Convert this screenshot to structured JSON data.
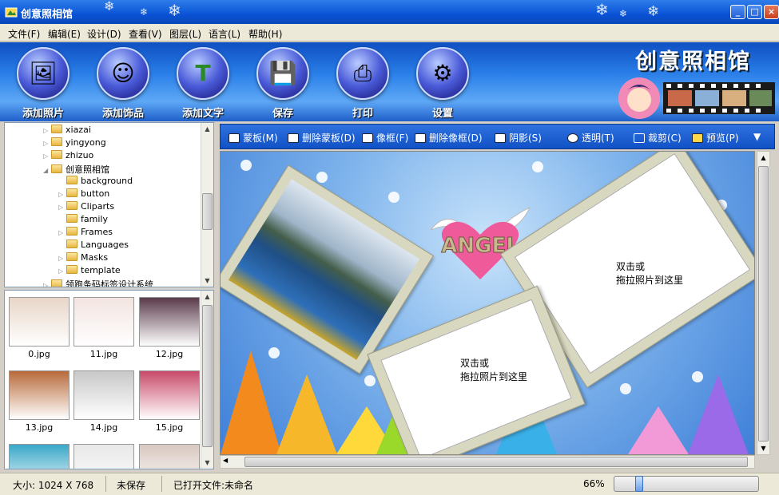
{
  "window": {
    "title": "创意照相馆",
    "minimize": "_",
    "maximize": "□",
    "close": "×"
  },
  "menu": [
    "文件(F)",
    "编辑(E)",
    "设计(D)",
    "查看(V)",
    "图层(L)",
    "语言(L)",
    "帮助(H)"
  ],
  "toolbar": {
    "buttons": [
      {
        "label": "添加照片",
        "icon": "add-photo-icon"
      },
      {
        "label": "添加饰品",
        "icon": "add-decoration-icon"
      },
      {
        "label": "添加文字",
        "icon": "add-text-icon"
      },
      {
        "label": "保存",
        "icon": "save-icon"
      },
      {
        "label": "打印",
        "icon": "print-icon"
      },
      {
        "label": "设置",
        "icon": "settings-icon"
      }
    ],
    "brand": "创意照相馆"
  },
  "tree": {
    "items": [
      {
        "label": "xiazai",
        "level": 0,
        "expander": "▷"
      },
      {
        "label": "yingyong",
        "level": 0,
        "expander": "▷"
      },
      {
        "label": "zhizuo",
        "level": 0,
        "expander": "▷"
      },
      {
        "label": "创意照相馆",
        "level": 0,
        "expander": "◢"
      },
      {
        "label": "background",
        "level": 1,
        "expander": ""
      },
      {
        "label": "button",
        "level": 1,
        "expander": "▷"
      },
      {
        "label": "Cliparts",
        "level": 1,
        "expander": "▷"
      },
      {
        "label": "family",
        "level": 1,
        "expander": ""
      },
      {
        "label": "Frames",
        "level": 1,
        "expander": "▷"
      },
      {
        "label": "Languages",
        "level": 1,
        "expander": ""
      },
      {
        "label": "Masks",
        "level": 1,
        "expander": "▷"
      },
      {
        "label": "template",
        "level": 1,
        "expander": "▷"
      },
      {
        "label": "领跑条码标签设计系统",
        "level": 0,
        "expander": "▷"
      }
    ]
  },
  "thumbnails": [
    {
      "file": "0.jpg",
      "color": "#e8d6c8"
    },
    {
      "file": "11.jpg",
      "color": "#f2e4e0"
    },
    {
      "file": "12.jpg",
      "color": "#5a3a4a"
    },
    {
      "file": "13.jpg",
      "color": "#b86a3a"
    },
    {
      "file": "14.jpg",
      "color": "#c8c8c8"
    },
    {
      "file": "15.jpg",
      "color": "#c84a6a"
    },
    {
      "file": "",
      "color": "#3aa8c8"
    },
    {
      "file": "",
      "color": "#e8e8e8"
    },
    {
      "file": "",
      "color": "#d8c8c0"
    }
  ],
  "edit_toolbar": {
    "items": [
      "蒙板(M)",
      "删除蒙板(D)",
      "像框(F)",
      "删除像框(D)",
      "阴影(S)",
      "透明(T)",
      "裁剪(C)",
      "预览(P)"
    ],
    "more": "▼"
  },
  "canvas": {
    "hint1": "双击或",
    "hint2": "拖拉照片到这里",
    "angel_text": "ANGEL"
  },
  "status": {
    "size": "大小: 1024 X 768",
    "saved": "未保存",
    "opened": "已打开文件:未命名",
    "zoom": "66%",
    "zoom_value": 0.15
  },
  "colors": {
    "accent": "#1151c6",
    "title": "#0a53d6"
  }
}
